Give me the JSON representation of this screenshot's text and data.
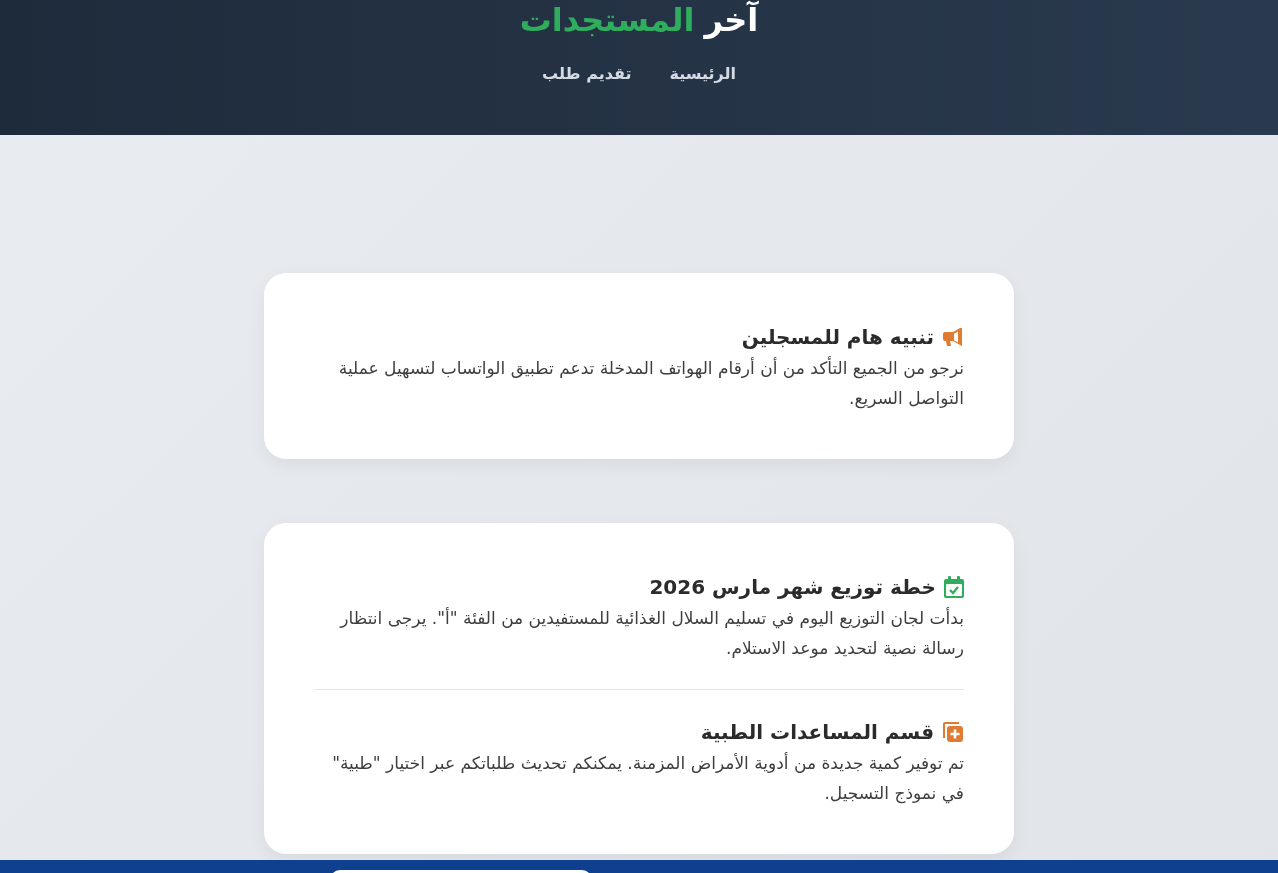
{
  "header": {
    "title": {
      "main": "آخر",
      "highlight": "المستجدات"
    },
    "nav": [
      {
        "label": "الرئيسية"
      },
      {
        "label": "تقديم طلب"
      }
    ]
  },
  "cards": [
    {
      "items": [
        {
          "kind": "alert",
          "title": "تنبيه هام للمسجلين",
          "text": "نرجو من الجميع التأكد من أن أرقام الهواتف المدخلة تدعم تطبيق الواتساب لتسهيل عملية التواصل السريع."
        }
      ]
    },
    {
      "items": [
        {
          "kind": "calendar",
          "title": "خطة توزيع شهر مارس 2026",
          "text": "بدأت لجان التوزيع اليوم في تسليم السلال الغذائية للمستفيدين من الفئة \"أ\". يرجى انتظار رسالة نصية لتحديد موعد الاستلام."
        },
        {
          "kind": "medical",
          "title": "قسم المساعدات الطبية",
          "text": "تم توفير كمية جديدة من أدوية الأمراض المزمنة. يمكنكم تحديث طلباتكم عبر اختيار \"طبية\" في نموذج التسجيل."
        }
      ]
    }
  ]
}
